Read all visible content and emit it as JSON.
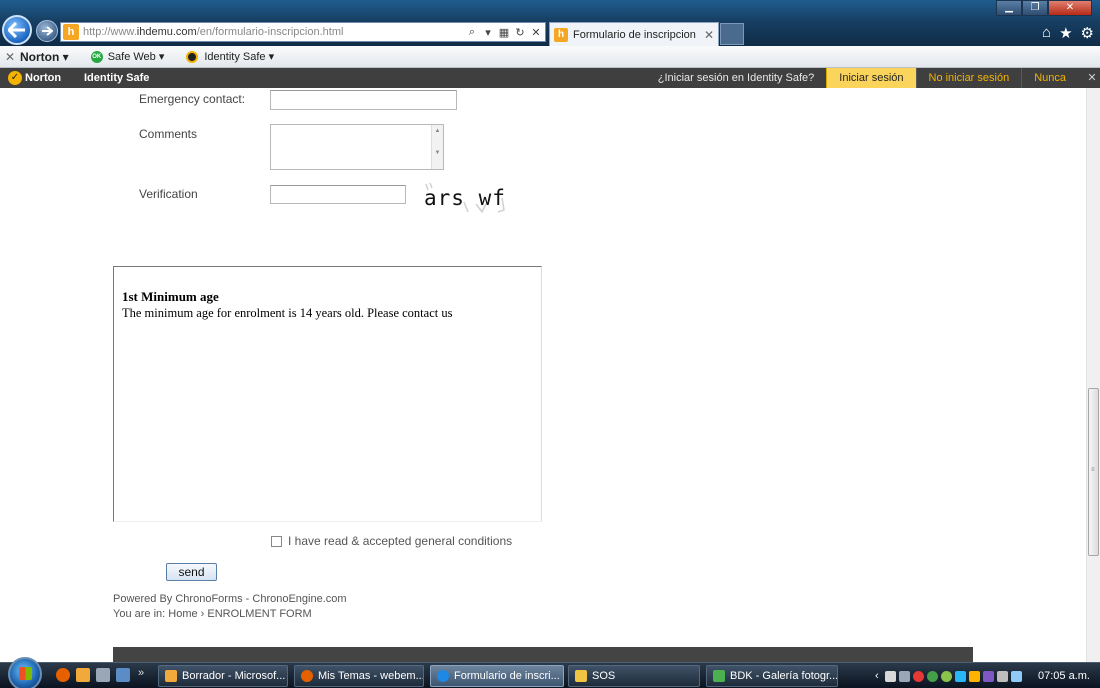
{
  "browser": {
    "url_prefix": "http://www.",
    "url_domain": "ihdemu.com",
    "url_path": "/en/formulario-inscripcion.html",
    "tab_title": "Formulario de inscripcion"
  },
  "norton_toolbar": {
    "brand": "Norton",
    "safe_web": "Safe Web",
    "safe_web_badge": "OK",
    "identity_safe": "Identity Safe"
  },
  "identity_bar": {
    "logo": "Norton",
    "title": "Identity Safe",
    "question": "¿Iniciar sesión en Identity Safe?",
    "login": "Iniciar sesión",
    "no_login": "No iniciar sesión",
    "never": "Nunca"
  },
  "form": {
    "emergency_label": "Emergency contact:",
    "comments_label": "Comments",
    "verification_label": "Verification",
    "captcha_text": "ars wf",
    "terms_heading": "1st Minimum age",
    "terms_body": "The minimum age for enrolment is 14 years old. Please contact us",
    "accept_label": "I have read & accepted general conditions",
    "send_label": "send"
  },
  "footer": {
    "powered_by": "Powered By ChronoForms - ChronoEngine.com",
    "breadcrumb_prefix": "You are in:",
    "breadcrumb_home": "Home",
    "breadcrumb_sep": "›",
    "breadcrumb_current": "ENROLMENT FORM"
  },
  "taskbar": {
    "tasks": [
      {
        "label": "Borrador - Microsof...",
        "icon_color": "#f2a93b"
      },
      {
        "label": "Mis Temas - webem...",
        "icon_color": "#e66000"
      },
      {
        "label": "Formulario de inscri...",
        "icon_color": "#1e88e5"
      },
      {
        "label": "SOS",
        "icon_color": "#f0c541"
      },
      {
        "label": "BDK - Galería fotogr...",
        "icon_color": "#4caf50"
      }
    ],
    "clock": "07:05 a.m."
  },
  "colors": {
    "idbar_bg": "#3f3f3f",
    "idbar_highlight": "#fbd45c",
    "idbar_link": "#f3b300",
    "brand_accent": "#f5a623"
  }
}
